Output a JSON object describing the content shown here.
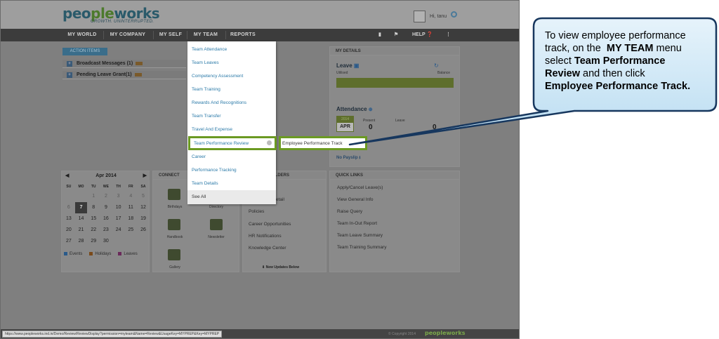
{
  "header": {
    "logo_part1": "peo",
    "logo_part2": "ple",
    "logo_part3": "works",
    "tagline": "GROWTH. UNINTERRUPTED.",
    "greeting": "Hi, tanu"
  },
  "nav": {
    "items": [
      "MY WORLD",
      "MY COMPANY",
      "MY SELF",
      "MY TEAM",
      "REPORTS"
    ],
    "help": "HELP"
  },
  "action_items": {
    "tab": "ACTION ITEMS",
    "rows": [
      "Broadcast Messages (1)",
      "Pending Leave Grant(1)"
    ]
  },
  "my_details": {
    "title": "MY DETAILS",
    "leave": "Leave",
    "utilised": "Utilised",
    "balance": "Balance",
    "attendance": "Attendance",
    "apr_day": "2014",
    "apr_month": "APR",
    "present_label": "Present",
    "present_value": "0",
    "leave_label": "Leave",
    "holiday_value": "0",
    "no_payslip": "No Payslip"
  },
  "calendar": {
    "month": "Apr 2014",
    "dow": [
      "SU",
      "MO",
      "TU",
      "WE",
      "TH",
      "FR",
      "SA"
    ],
    "rows": [
      [
        "",
        "",
        "1",
        "2",
        "3",
        "4",
        "5"
      ],
      [
        "6",
        "7",
        "8",
        "9",
        "10",
        "11",
        "12"
      ],
      [
        "13",
        "14",
        "15",
        "16",
        "17",
        "18",
        "19"
      ],
      [
        "20",
        "21",
        "22",
        "23",
        "24",
        "25",
        "26"
      ],
      [
        "27",
        "28",
        "29",
        "30",
        "",
        "",
        ""
      ]
    ],
    "today": "7",
    "legend": [
      "Events",
      "Holidays",
      "Leaves"
    ]
  },
  "connect": {
    "title": "CONNECT",
    "items": [
      "Birthdays",
      "Directory",
      "Handbook",
      "Newsletter",
      "Gallery"
    ]
  },
  "middle_panel": {
    "title_fragment": "LDERS",
    "links": [
      "etail",
      "Policies",
      "Career Opportunities",
      "HR Notifications",
      "Knowledge Center"
    ],
    "new_updates": "New Updates Below"
  },
  "quick_links": {
    "title": "QUICK LINKS",
    "links": [
      "Apply/Cancel Leave(s)",
      "View General Info",
      "Raise Query",
      "Team In-Out Report",
      "Team Leave Summary",
      "Team Training Summary"
    ]
  },
  "dropdown": {
    "items": [
      "Team Attendance",
      "Team Leaves",
      "Competency Assessment",
      "Team Training",
      "Rewards And Recognitions",
      "Team Transfer",
      "Travel And Expense",
      "Team Performance Review",
      "Career",
      "Performance Tracking",
      "Team Details",
      "See All"
    ],
    "submenu": "Employee Performance Track"
  },
  "footer": {
    "status_url": "https://www.peopleworks.ind.in/Demo/Review/ReviewDisplay?permission=myteam&Name=Review&UsageKey=MYPREP&Key=MYPREP",
    "copyright": "© Copyright 2014",
    "logo": "peopleworks"
  },
  "callout": {
    "line1": "To view employee performance",
    "line2": "track, on the",
    "line2_bold": "MY TEAM",
    "line2_end": "menu",
    "line3": "select",
    "line3_bold": "Team Performance",
    "line4_bold": "Review",
    "line4_end": "and then click",
    "line5_bold": "Employee Performance Track."
  }
}
